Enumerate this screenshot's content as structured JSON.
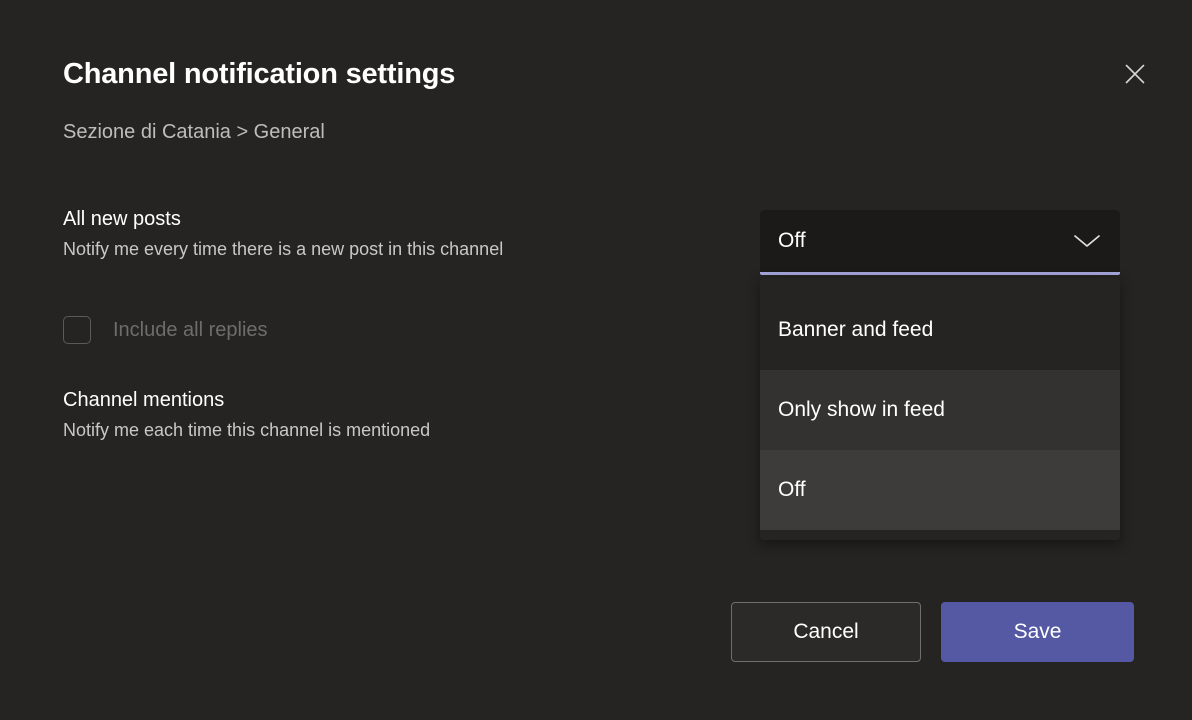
{
  "dialog": {
    "title": "Channel notification settings",
    "breadcrumb": "Sezione di Catania > General",
    "close_icon": "close-icon"
  },
  "settings": [
    {
      "id": "all-new-posts",
      "title": "All new posts",
      "description": "Notify me every time there is a new post in this channel"
    },
    {
      "id": "channel-mentions",
      "title": "Channel mentions",
      "description": "Notify me each time this channel is mentioned"
    }
  ],
  "include_replies": {
    "label": "Include all replies",
    "checked": false,
    "disabled": true
  },
  "dropdown": {
    "selected_value": "Off",
    "expanded": true,
    "chevron_icon": "chevron-down-icon",
    "options": [
      {
        "label": "Banner and feed",
        "state": "normal"
      },
      {
        "label": "Only show in feed",
        "state": "hover"
      },
      {
        "label": "Off",
        "state": "selected"
      }
    ]
  },
  "footer": {
    "cancel_label": "Cancel",
    "save_label": "Save"
  },
  "colors": {
    "background": "#252423",
    "accent_underline": "#a6a7dc",
    "primary_button": "#5559a4",
    "combobox_background": "#1b1a19",
    "secondary_text": "#c8c8c8",
    "disabled_text": "#6d6d6d"
  }
}
